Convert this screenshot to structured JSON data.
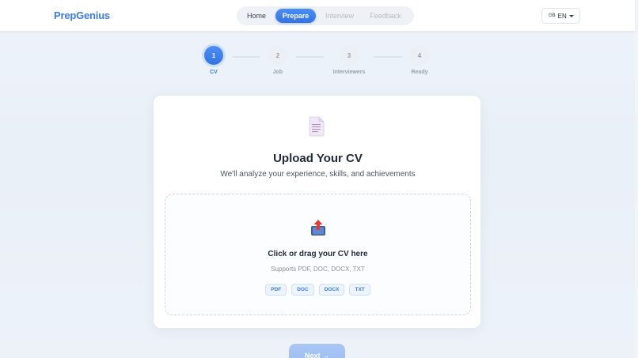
{
  "header": {
    "logo": "PrepGenius",
    "nav": [
      {
        "label": "Home",
        "state": "default"
      },
      {
        "label": "Prepare",
        "state": "active"
      },
      {
        "label": "Interview",
        "state": "disabled"
      },
      {
        "label": "Feedback",
        "state": "disabled"
      }
    ],
    "language": {
      "flag": "GB",
      "value": "EN"
    }
  },
  "stepper": {
    "steps": [
      {
        "number": "1",
        "label": "CV",
        "active": true
      },
      {
        "number": "2",
        "label": "Job",
        "active": false
      },
      {
        "number": "3",
        "label": "Interviewers",
        "active": false
      },
      {
        "number": "4",
        "label": "Ready",
        "active": false
      }
    ]
  },
  "upload_card": {
    "icon": "document-icon",
    "title": "Upload Your CV",
    "subtitle": "We'll analyze your experience, skills, and achievements",
    "dropzone": {
      "icon": "upload-icon",
      "title": "Click or drag your CV here",
      "supports": "Supports PDF, DOC, DOCX, TXT",
      "formats": [
        "PDF",
        "DOC",
        "DOCX",
        "TXT"
      ]
    }
  },
  "footer": {
    "next_label": "Next →"
  },
  "colors": {
    "accent": "#3b7be8",
    "background": "#eef3fa",
    "card": "#ffffff",
    "muted_text": "#9aa1ab"
  }
}
